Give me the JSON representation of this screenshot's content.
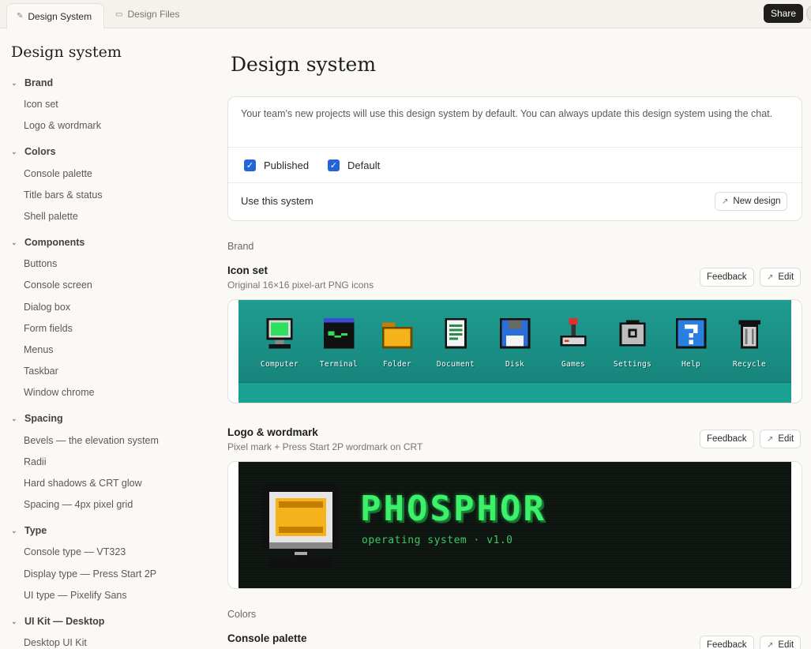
{
  "tabs": [
    {
      "label": "Design System",
      "icon": "pen-icon",
      "active": true
    },
    {
      "label": "Design Files",
      "icon": "file-icon",
      "active": false
    }
  ],
  "share_label": "Share",
  "sidebar": {
    "title": "Design system",
    "groups": [
      {
        "label": "Brand",
        "items": [
          "Icon set",
          "Logo & wordmark"
        ]
      },
      {
        "label": "Colors",
        "items": [
          "Console palette",
          "Title bars & status",
          "Shell palette"
        ]
      },
      {
        "label": "Components",
        "items": [
          "Buttons",
          "Console screen",
          "Dialog box",
          "Form fields",
          "Menus",
          "Taskbar",
          "Window chrome"
        ]
      },
      {
        "label": "Spacing",
        "items": [
          "Bevels — the elevation system",
          "Radii",
          "Hard shadows & CRT glow",
          "Spacing — 4px pixel grid"
        ]
      },
      {
        "label": "Type",
        "items": [
          "Console type — VT323",
          "Display type — Press Start 2P",
          "UI type — Pixelify Sans"
        ]
      },
      {
        "label": "UI Kit — Desktop",
        "items": [
          "Desktop UI Kit"
        ]
      }
    ]
  },
  "main": {
    "title": "Design system",
    "info": {
      "text": "Your team's new projects will use this design system by default. You can always update this design system using the chat.",
      "published_label": "Published",
      "default_label": "Default",
      "use_label": "Use this system",
      "new_design_label": "New design"
    },
    "feedback_label": "Feedback",
    "edit_label": "Edit",
    "sections": [
      {
        "label": "Brand"
      },
      {
        "label": "Colors"
      }
    ],
    "icon_set": {
      "title": "Icon set",
      "subtitle": "Original 16×16 pixel-art PNG icons",
      "icons": [
        "Computer",
        "Terminal",
        "Folder",
        "Document",
        "Disk",
        "Games",
        "Settings",
        "Help",
        "Recycle"
      ]
    },
    "logo": {
      "title": "Logo & wordmark",
      "subtitle": "Pixel mark + Press Start 2P wordmark on CRT",
      "wordmark": "PHOSPHOR",
      "tagline": "operating system · v1.0"
    },
    "console_palette": {
      "title": "Console palette"
    }
  }
}
